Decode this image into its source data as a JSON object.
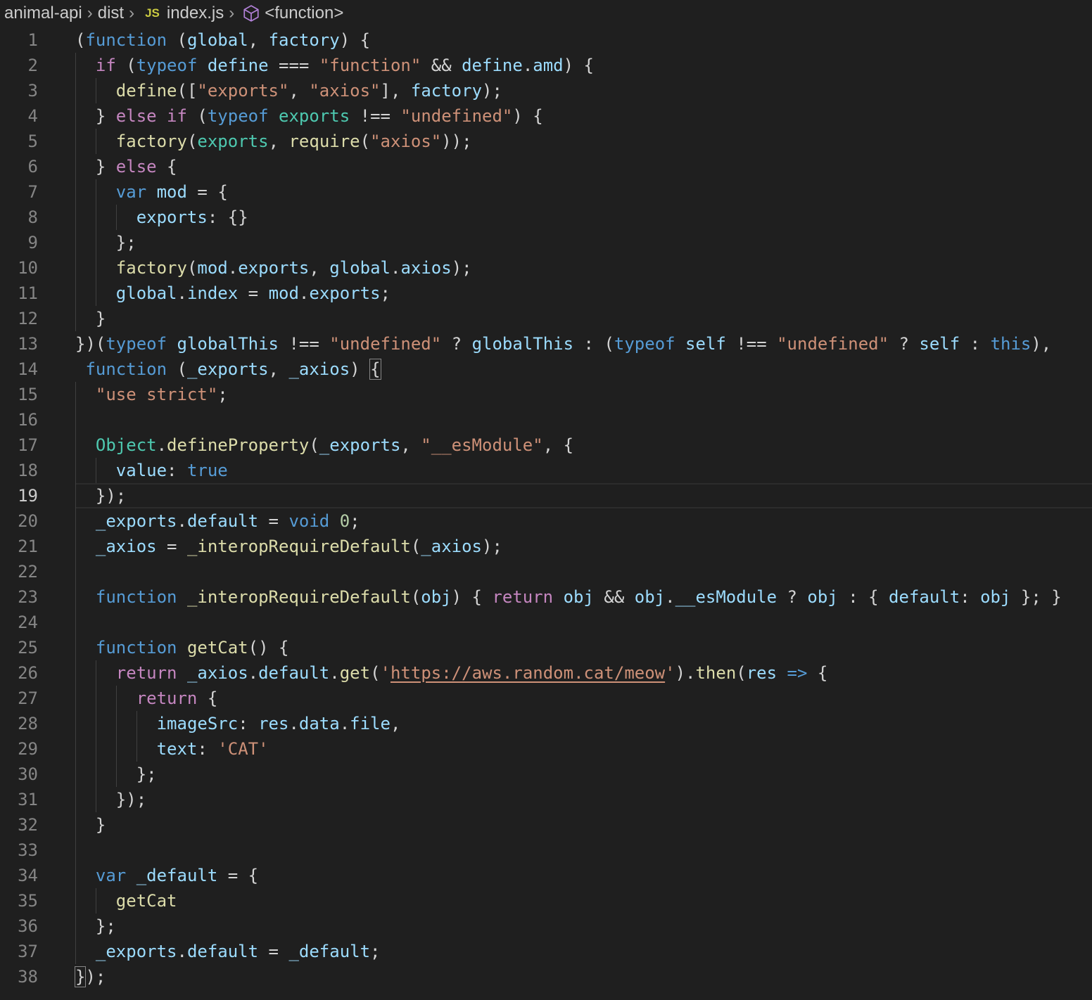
{
  "breadcrumb": {
    "items": [
      {
        "label": "animal-api",
        "icon": null
      },
      {
        "label": "dist",
        "icon": null
      },
      {
        "label": "index.js",
        "icon": "JS"
      },
      {
        "label": "<function>",
        "icon": "cube-icon"
      }
    ]
  },
  "editor": {
    "current_line": 19,
    "theme": {
      "background": "#1f1f1f",
      "keyword": "#569cd6",
      "control": "#c586c0",
      "string": "#ce9178",
      "function": "#dcdcaa",
      "variable": "#9cdcfe",
      "type": "#4ec9b0",
      "number": "#b5cea8"
    },
    "lines": [
      {
        "n": "1",
        "indent": 0,
        "tokens": [
          [
            "punc",
            "("
          ],
          [
            "kw",
            "function"
          ],
          [
            "text",
            " "
          ],
          [
            "punc",
            "("
          ],
          [
            "var",
            "global"
          ],
          [
            "punc",
            ", "
          ],
          [
            "var",
            "factory"
          ],
          [
            "punc",
            ") {"
          ]
        ]
      },
      {
        "n": "2",
        "indent": 1,
        "tokens": [
          [
            "ctrl",
            "if"
          ],
          [
            "text",
            " "
          ],
          [
            "punc",
            "("
          ],
          [
            "kw",
            "typeof"
          ],
          [
            "text",
            " "
          ],
          [
            "var",
            "define"
          ],
          [
            "op",
            " === "
          ],
          [
            "str",
            "\"function\""
          ],
          [
            "op",
            " && "
          ],
          [
            "var",
            "define"
          ],
          [
            "punc",
            "."
          ],
          [
            "var",
            "amd"
          ],
          [
            "punc",
            ") {"
          ]
        ]
      },
      {
        "n": "3",
        "indent": 2,
        "tokens": [
          [
            "fn",
            "define"
          ],
          [
            "punc",
            "(["
          ],
          [
            "str",
            "\"exports\""
          ],
          [
            "punc",
            ", "
          ],
          [
            "str",
            "\"axios\""
          ],
          [
            "punc",
            "], "
          ],
          [
            "var",
            "factory"
          ],
          [
            "punc",
            ");"
          ]
        ]
      },
      {
        "n": "4",
        "indent": 1,
        "tokens": [
          [
            "punc",
            "} "
          ],
          [
            "ctrl",
            "else"
          ],
          [
            "text",
            " "
          ],
          [
            "ctrl",
            "if"
          ],
          [
            "text",
            " "
          ],
          [
            "punc",
            "("
          ],
          [
            "kw",
            "typeof"
          ],
          [
            "text",
            " "
          ],
          [
            "type",
            "exports"
          ],
          [
            "op",
            " !== "
          ],
          [
            "str",
            "\"undefined\""
          ],
          [
            "punc",
            ") {"
          ]
        ]
      },
      {
        "n": "5",
        "indent": 2,
        "tokens": [
          [
            "fn",
            "factory"
          ],
          [
            "punc",
            "("
          ],
          [
            "type",
            "exports"
          ],
          [
            "punc",
            ", "
          ],
          [
            "fn",
            "require"
          ],
          [
            "punc",
            "("
          ],
          [
            "str",
            "\"axios\""
          ],
          [
            "punc",
            "));"
          ]
        ]
      },
      {
        "n": "6",
        "indent": 1,
        "tokens": [
          [
            "punc",
            "} "
          ],
          [
            "ctrl",
            "else"
          ],
          [
            "punc",
            " {"
          ]
        ]
      },
      {
        "n": "7",
        "indent": 2,
        "tokens": [
          [
            "kw",
            "var"
          ],
          [
            "text",
            " "
          ],
          [
            "var",
            "mod"
          ],
          [
            "op",
            " = "
          ],
          [
            "punc",
            "{"
          ]
        ]
      },
      {
        "n": "8",
        "indent": 3,
        "tokens": [
          [
            "var",
            "exports"
          ],
          [
            "punc",
            ": {}"
          ]
        ]
      },
      {
        "n": "9",
        "indent": 2,
        "tokens": [
          [
            "punc",
            "};"
          ]
        ]
      },
      {
        "n": "10",
        "indent": 2,
        "tokens": [
          [
            "fn",
            "factory"
          ],
          [
            "punc",
            "("
          ],
          [
            "var",
            "mod"
          ],
          [
            "punc",
            "."
          ],
          [
            "var",
            "exports"
          ],
          [
            "punc",
            ", "
          ],
          [
            "var",
            "global"
          ],
          [
            "punc",
            "."
          ],
          [
            "var",
            "axios"
          ],
          [
            "punc",
            ");"
          ]
        ]
      },
      {
        "n": "11",
        "indent": 2,
        "tokens": [
          [
            "var",
            "global"
          ],
          [
            "punc",
            "."
          ],
          [
            "var",
            "index"
          ],
          [
            "op",
            " = "
          ],
          [
            "var",
            "mod"
          ],
          [
            "punc",
            "."
          ],
          [
            "var",
            "exports"
          ],
          [
            "punc",
            ";"
          ]
        ]
      },
      {
        "n": "12",
        "indent": 1,
        "tokens": [
          [
            "punc",
            "}"
          ]
        ]
      },
      {
        "n": "13",
        "indent": 0,
        "tokens": [
          [
            "punc",
            "})("
          ],
          [
            "kw",
            "typeof"
          ],
          [
            "text",
            " "
          ],
          [
            "var",
            "globalThis"
          ],
          [
            "op",
            " !== "
          ],
          [
            "str",
            "\"undefined\""
          ],
          [
            "op",
            " ? "
          ],
          [
            "var",
            "globalThis"
          ],
          [
            "op",
            " : "
          ],
          [
            "punc",
            "("
          ],
          [
            "kw",
            "typeof"
          ],
          [
            "text",
            " "
          ],
          [
            "var",
            "self"
          ],
          [
            "op",
            " !== "
          ],
          [
            "str",
            "\"undefined\""
          ],
          [
            "op",
            " ? "
          ],
          [
            "var",
            "self"
          ],
          [
            "op",
            " : "
          ],
          [
            "kw",
            "this"
          ],
          [
            "punc",
            "),"
          ]
        ]
      },
      {
        "n": "14",
        "indent": 0,
        "tokens": [
          [
            "text",
            " "
          ],
          [
            "kw",
            "function"
          ],
          [
            "text",
            " "
          ],
          [
            "punc",
            "("
          ],
          [
            "var",
            "_exports"
          ],
          [
            "punc",
            ", "
          ],
          [
            "var",
            "_axios"
          ],
          [
            "punc",
            ") "
          ],
          [
            "bracket",
            "{"
          ]
        ]
      },
      {
        "n": "15",
        "indent": 1,
        "tokens": [
          [
            "str",
            "\"use strict\""
          ],
          [
            "punc",
            ";"
          ]
        ]
      },
      {
        "n": "16",
        "indent": 1,
        "tokens": []
      },
      {
        "n": "17",
        "indent": 1,
        "tokens": [
          [
            "type",
            "Object"
          ],
          [
            "punc",
            "."
          ],
          [
            "fn",
            "defineProperty"
          ],
          [
            "punc",
            "("
          ],
          [
            "var",
            "_exports"
          ],
          [
            "punc",
            ", "
          ],
          [
            "str",
            "\"__esModule\""
          ],
          [
            "punc",
            ", {"
          ]
        ]
      },
      {
        "n": "18",
        "indent": 2,
        "tokens": [
          [
            "var",
            "value"
          ],
          [
            "punc",
            ": "
          ],
          [
            "kw",
            "true"
          ]
        ]
      },
      {
        "n": "19",
        "indent": 1,
        "tokens": [
          [
            "punc",
            "});"
          ]
        ]
      },
      {
        "n": "20",
        "indent": 1,
        "tokens": [
          [
            "var",
            "_exports"
          ],
          [
            "punc",
            "."
          ],
          [
            "var",
            "default"
          ],
          [
            "op",
            " = "
          ],
          [
            "kw",
            "void"
          ],
          [
            "text",
            " "
          ],
          [
            "num",
            "0"
          ],
          [
            "punc",
            ";"
          ]
        ]
      },
      {
        "n": "21",
        "indent": 1,
        "tokens": [
          [
            "var",
            "_axios"
          ],
          [
            "op",
            " = "
          ],
          [
            "fn",
            "_interopRequireDefault"
          ],
          [
            "punc",
            "("
          ],
          [
            "var",
            "_axios"
          ],
          [
            "punc",
            ");"
          ]
        ]
      },
      {
        "n": "22",
        "indent": 1,
        "tokens": []
      },
      {
        "n": "23",
        "indent": 1,
        "tokens": [
          [
            "kw",
            "function"
          ],
          [
            "text",
            " "
          ],
          [
            "fn",
            "_interopRequireDefault"
          ],
          [
            "punc",
            "("
          ],
          [
            "var",
            "obj"
          ],
          [
            "punc",
            ") { "
          ],
          [
            "ctrl",
            "return"
          ],
          [
            "text",
            " "
          ],
          [
            "var",
            "obj"
          ],
          [
            "op",
            " && "
          ],
          [
            "var",
            "obj"
          ],
          [
            "punc",
            "."
          ],
          [
            "var",
            "__esModule"
          ],
          [
            "op",
            " ? "
          ],
          [
            "var",
            "obj"
          ],
          [
            "op",
            " : "
          ],
          [
            "punc",
            "{ "
          ],
          [
            "var",
            "default"
          ],
          [
            "punc",
            ": "
          ],
          [
            "var",
            "obj"
          ],
          [
            "punc",
            " }; }"
          ]
        ]
      },
      {
        "n": "24",
        "indent": 1,
        "tokens": []
      },
      {
        "n": "25",
        "indent": 1,
        "tokens": [
          [
            "kw",
            "function"
          ],
          [
            "text",
            " "
          ],
          [
            "fn",
            "getCat"
          ],
          [
            "punc",
            "() {"
          ]
        ]
      },
      {
        "n": "26",
        "indent": 2,
        "tokens": [
          [
            "ctrl",
            "return"
          ],
          [
            "text",
            " "
          ],
          [
            "var",
            "_axios"
          ],
          [
            "punc",
            "."
          ],
          [
            "var",
            "default"
          ],
          [
            "punc",
            "."
          ],
          [
            "fn",
            "get"
          ],
          [
            "punc",
            "("
          ],
          [
            "str",
            "'"
          ],
          [
            "link",
            "https://aws.random.cat/meow"
          ],
          [
            "str",
            "'"
          ],
          [
            "punc",
            ")."
          ],
          [
            "fn",
            "then"
          ],
          [
            "punc",
            "("
          ],
          [
            "var",
            "res"
          ],
          [
            "text",
            " "
          ],
          [
            "kw",
            "=>"
          ],
          [
            "punc",
            " {"
          ]
        ]
      },
      {
        "n": "27",
        "indent": 3,
        "tokens": [
          [
            "ctrl",
            "return"
          ],
          [
            "punc",
            " {"
          ]
        ]
      },
      {
        "n": "28",
        "indent": 4,
        "tokens": [
          [
            "var",
            "imageSrc"
          ],
          [
            "punc",
            ": "
          ],
          [
            "var",
            "res"
          ],
          [
            "punc",
            "."
          ],
          [
            "var",
            "data"
          ],
          [
            "punc",
            "."
          ],
          [
            "var",
            "file"
          ],
          [
            "punc",
            ","
          ]
        ]
      },
      {
        "n": "29",
        "indent": 4,
        "tokens": [
          [
            "var",
            "text"
          ],
          [
            "punc",
            ": "
          ],
          [
            "str",
            "'CAT'"
          ]
        ]
      },
      {
        "n": "30",
        "indent": 3,
        "tokens": [
          [
            "punc",
            "};"
          ]
        ]
      },
      {
        "n": "31",
        "indent": 2,
        "tokens": [
          [
            "punc",
            "});"
          ]
        ]
      },
      {
        "n": "32",
        "indent": 1,
        "tokens": [
          [
            "punc",
            "}"
          ]
        ]
      },
      {
        "n": "33",
        "indent": 1,
        "tokens": []
      },
      {
        "n": "34",
        "indent": 1,
        "tokens": [
          [
            "kw",
            "var"
          ],
          [
            "text",
            " "
          ],
          [
            "var",
            "_default"
          ],
          [
            "op",
            " = "
          ],
          [
            "punc",
            "{"
          ]
        ]
      },
      {
        "n": "35",
        "indent": 2,
        "tokens": [
          [
            "fn",
            "getCat"
          ]
        ]
      },
      {
        "n": "36",
        "indent": 1,
        "tokens": [
          [
            "punc",
            "};"
          ]
        ]
      },
      {
        "n": "37",
        "indent": 1,
        "tokens": [
          [
            "var",
            "_exports"
          ],
          [
            "punc",
            "."
          ],
          [
            "var",
            "default"
          ],
          [
            "op",
            " = "
          ],
          [
            "var",
            "_default"
          ],
          [
            "punc",
            ";"
          ]
        ]
      },
      {
        "n": "38",
        "indent": 0,
        "tokens": [
          [
            "bracket",
            "}"
          ],
          [
            "punc",
            ");"
          ]
        ]
      }
    ]
  }
}
